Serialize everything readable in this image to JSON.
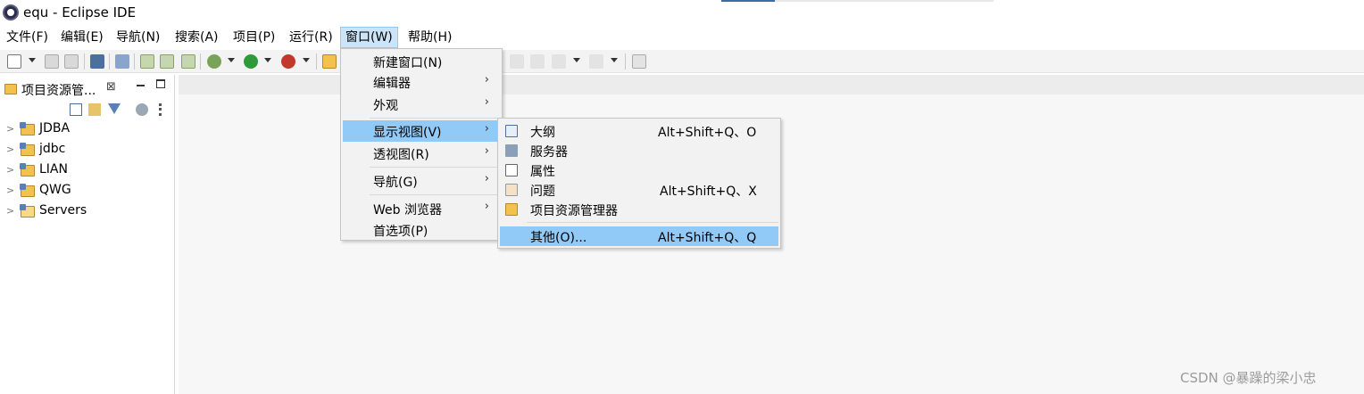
{
  "window": {
    "title": "equ - Eclipse IDE"
  },
  "menubar": {
    "items": [
      {
        "label": "文件(F)"
      },
      {
        "label": "编辑(E)"
      },
      {
        "label": "导航(N)"
      },
      {
        "label": "搜索(A)"
      },
      {
        "label": "项目(P)"
      },
      {
        "label": "运行(R)"
      },
      {
        "label": "窗口(W)"
      },
      {
        "label": "帮助(H)"
      }
    ],
    "open_item": "窗口(W)"
  },
  "left_panel": {
    "tab_label": "项目资源管...",
    "close_glyph": "⊠",
    "projects": [
      {
        "label": "JDBA"
      },
      {
        "label": "jdbc"
      },
      {
        "label": "LIAN"
      },
      {
        "label": "QWG"
      },
      {
        "label": "Servers"
      }
    ]
  },
  "window_menu": {
    "items": [
      {
        "label": "新建窗口(N)"
      },
      {
        "label": "编辑器"
      },
      {
        "label": "外观"
      },
      {
        "label": "显示视图(V)"
      },
      {
        "label": "透视图(R)"
      },
      {
        "label": "导航(G)"
      },
      {
        "label": "Web 浏览器"
      },
      {
        "label": "首选项(P)"
      }
    ],
    "submenu_glyph": "›",
    "selected": "显示视图(V)"
  },
  "show_view_submenu": {
    "items": [
      {
        "label": "大纲",
        "accelerator": "Alt+Shift+Q、O"
      },
      {
        "label": "服务器",
        "accelerator": ""
      },
      {
        "label": "属性",
        "accelerator": ""
      },
      {
        "label": "问题",
        "accelerator": "Alt+Shift+Q、X"
      },
      {
        "label": "项目资源管理器",
        "accelerator": ""
      },
      {
        "label": "其他(O)...",
        "accelerator": "Alt+Shift+Q、Q"
      }
    ],
    "selected": "其他(O)..."
  },
  "watermark": "CSDN @暴躁的梁小忠",
  "colors": {
    "menu_highlight": "#91c9f7",
    "menubar_open": "#cce4f7",
    "toolbar_bg": "#f3f3f3",
    "editor_bg": "#f7f7f7"
  }
}
